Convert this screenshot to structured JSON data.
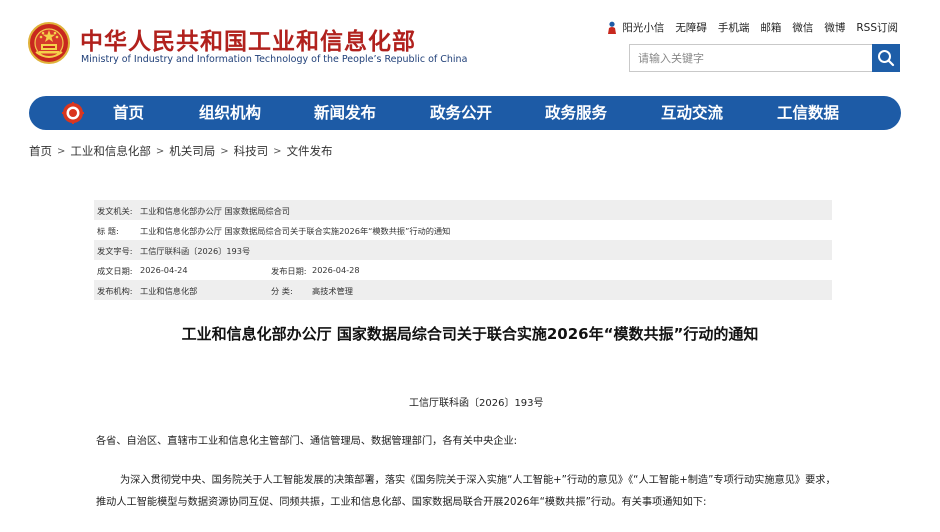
{
  "header": {
    "title": "中华人民共和国工业和信息化部",
    "subtitle": "Ministry of Industry and Information Technology of the People’s Republic of China",
    "top_links": [
      "阳光小信",
      "无障碍",
      "手机端",
      "邮箱",
      "微信",
      "微博",
      "RSS订阅"
    ],
    "search_placeholder": "请输入关键字"
  },
  "nav": {
    "items": [
      "首页",
      "组织机构",
      "新闻发布",
      "政务公开",
      "政务服务",
      "互动交流",
      "工信数据"
    ]
  },
  "breadcrumb": [
    "首页",
    "工业和信息化部",
    "机关司局",
    "科技司",
    "文件发布"
  ],
  "info": {
    "issuer_label": "发文机关:",
    "issuer": "工业和信息化部办公厅 国家数据局综合司",
    "title_label": "标      题:",
    "title": "工业和信息化部办公厅 国家数据局综合司关于联合实施2026年“模数共振”行动的通知",
    "doc_no_label": "发文字号:",
    "doc_no": "工信厅联科函〔2026〕193号",
    "created_label": "成文日期:",
    "created": "2026-04-24",
    "published_label": "发布日期:",
    "published": "2026-04-28",
    "publisher_label": "发布机构:",
    "publisher": "工业和信息化部",
    "category_label": "分      类:",
    "category": "高技术管理"
  },
  "article": {
    "title": "工业和信息化部办公厅 国家数据局综合司关于联合实施2026年“模数共振”行动的通知",
    "doc_number": "工信厅联科函〔2026〕193号",
    "salutation": "各省、自治区、直辖市工业和信息化主管部门、通信管理局、数据管理部门，各有关中央企业:",
    "paragraph": "为深入贯彻党中央、国务院关于人工智能发展的决策部署，落实《国务院关于深入实施“人工智能+”行动的意见》《“人工智能+制造”专项行动实施意见》要求，推动人工智能模型与数据资源协同互促、同频共振，工业和信息化部、国家数据局联合开展2026年“模数共振”行动。有关事项通知如下:"
  },
  "colors": {
    "brand_red": "#b1211d",
    "nav_blue": "#1d5ba6",
    "search_blue": "#1e5ea8"
  }
}
